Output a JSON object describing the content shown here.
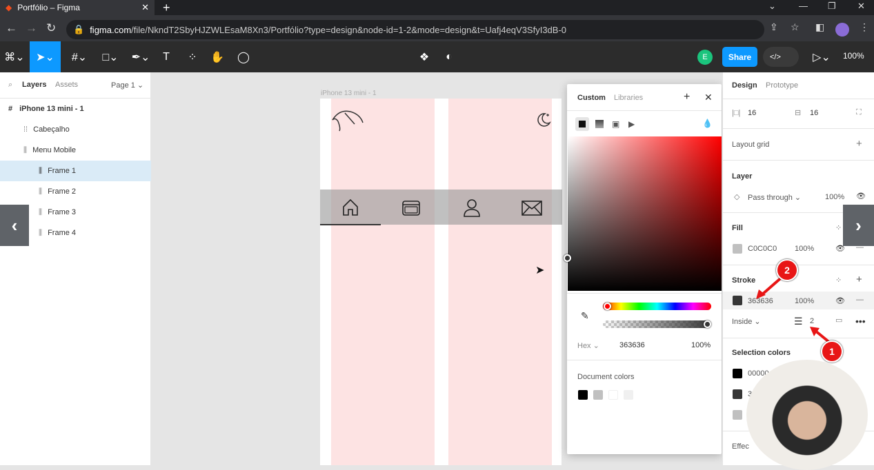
{
  "browser": {
    "tab_title": "Portfólio – Figma",
    "url_host": "figma.com",
    "url_path": "/file/NkndT2SbyHJZWLEsaM8Xn3/Portfólio?type=design&node-id=1-2&mode=design&t=Uafj4eqV3SfyI3dB-0"
  },
  "toolbar": {
    "share_label": "Share",
    "avatar_initial": "E",
    "zoom": "100%",
    "colors": {
      "accent": "#0d99ff",
      "bg": "#2c2c2c"
    }
  },
  "left_panel": {
    "tabs": [
      "Layers",
      "Assets"
    ],
    "page": "Page 1",
    "layers": [
      {
        "name": "iPhone 13 mini - 1"
      },
      {
        "name": "Cabeçalho"
      },
      {
        "name": "Menu Mobile"
      },
      {
        "name": "Frame 1"
      },
      {
        "name": "Frame 2"
      },
      {
        "name": "Frame 3"
      },
      {
        "name": "Frame 4"
      }
    ]
  },
  "canvas": {
    "frame_label": "iPhone 13 mini - 1",
    "menu_icons": [
      "home-icon",
      "browser-window-icon",
      "user-icon",
      "mail-icon"
    ]
  },
  "color_picker": {
    "tabs": [
      "Custom",
      "Libraries"
    ],
    "hex_label": "Hex",
    "hex_value": "363636",
    "opacity": "100%",
    "document_colors_label": "Document colors",
    "document_colors": [
      "#000000",
      "#c0c0c0",
      "#ffffff",
      "#f0f0f0"
    ]
  },
  "right_panel": {
    "tabs": [
      "Design",
      "Prototype"
    ],
    "padding_h": "16",
    "padding_v": "16",
    "layout_grid": "Layout grid",
    "layer_title": "Layer",
    "blend_mode": "Pass through",
    "layer_opacity": "100%",
    "fill_title": "Fill",
    "fill_hex": "C0C0C0",
    "fill_opacity": "100%",
    "stroke_title": "Stroke",
    "stroke_hex": "363636",
    "stroke_opacity": "100%",
    "stroke_position": "Inside",
    "stroke_weight": "2",
    "selection_colors_title": "Selection colors",
    "selection_colors": [
      {
        "hex": "00000",
        "color": "#000000"
      },
      {
        "hex": "3",
        "color": "#363636"
      },
      {
        "hex": "",
        "color": "#c0c0c0"
      }
    ],
    "effects_title": "Effec"
  },
  "annotations": {
    "badge1": "1",
    "badge2": "2"
  }
}
